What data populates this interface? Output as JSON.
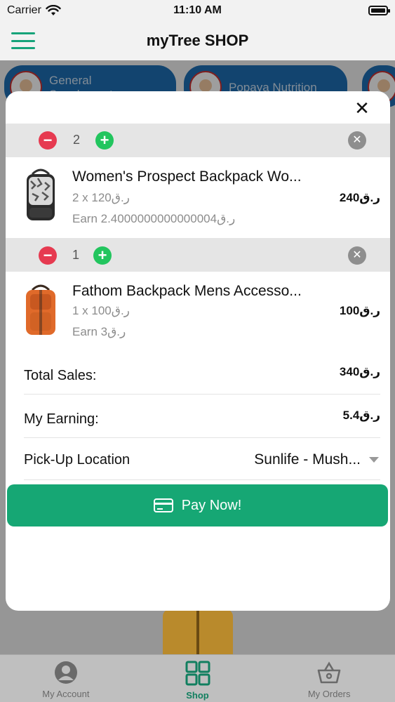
{
  "status": {
    "carrier": "Carrier",
    "time": "11:10 AM"
  },
  "header": {
    "title": "myTree SHOP"
  },
  "chips": [
    {
      "label": "General Supplements"
    },
    {
      "label": "Popaya Nutrition"
    }
  ],
  "cart": {
    "items": [
      {
        "quantity": "2",
        "name": "Women's Prospect Backpack Wo...",
        "unit_line": "2 x 120ر.ق",
        "earn_line": "Earn 2.4000000000000004ر.ق",
        "price": "240ر.ق"
      },
      {
        "quantity": "1",
        "name": "Fathom Backpack Mens Accesso...",
        "unit_line": "1 x 100ر.ق",
        "earn_line": "Earn 3ر.ق",
        "price": "100ر.ق"
      }
    ],
    "summary": {
      "total_label": "Total Sales:",
      "total_value": "340ر.ق",
      "earning_label": "My Earning:",
      "earning_value": "5.4ر.ق",
      "pickup_label": "Pick-Up Location",
      "pickup_value": "Sunlife - Mush..."
    },
    "pay_label": "Pay Now!"
  },
  "tabs": [
    {
      "label": "My Account"
    },
    {
      "label": "Shop"
    },
    {
      "label": "My Orders"
    }
  ],
  "colors": {
    "accent": "#16a774",
    "minus": "#e63a50",
    "plus": "#22c55e"
  }
}
